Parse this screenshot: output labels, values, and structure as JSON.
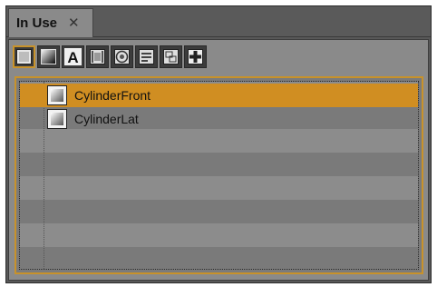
{
  "tab": {
    "label": "In Use",
    "close": "✕"
  },
  "toolbar": {
    "buttons": [
      {
        "name": "material-filter-button",
        "icon": "material-swatch-icon",
        "active": true
      },
      {
        "name": "texture-filter-button",
        "icon": "gradient-texture-icon",
        "active": false
      },
      {
        "name": "font-filter-button",
        "icon": "font-a-icon",
        "active": false
      },
      {
        "name": "image-filter-button",
        "icon": "film-image-icon",
        "active": false
      },
      {
        "name": "sound-filter-button",
        "icon": "speaker-icon",
        "active": false
      },
      {
        "name": "data-filter-button",
        "icon": "list-data-icon",
        "active": false
      },
      {
        "name": "layout-filter-button",
        "icon": "layout-icon",
        "active": false
      },
      {
        "name": "add-filter-button",
        "icon": "plus-icon",
        "active": false
      }
    ]
  },
  "list": {
    "items": [
      {
        "label": "CylinderFront",
        "selected": true
      },
      {
        "label": "CylinderLat",
        "selected": false
      }
    ]
  },
  "colors": {
    "selection": "#d08e22",
    "accent_border": "#c8922a"
  }
}
